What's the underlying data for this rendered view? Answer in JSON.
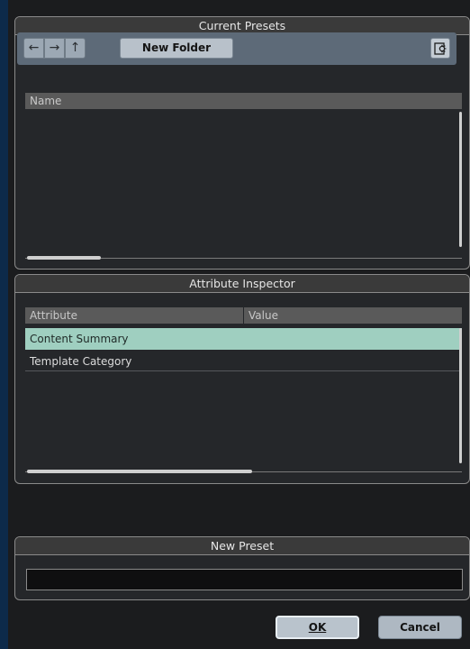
{
  "current_presets": {
    "title": "Current Presets",
    "toolbar": {
      "back_icon": "arrow-left-icon",
      "forward_icon": "arrow-right-icon",
      "up_icon": "arrow-up-icon",
      "new_folder_label": "New Folder",
      "settings_icon": "settings-icon"
    },
    "columns": [
      "Name"
    ],
    "items": []
  },
  "attribute_inspector": {
    "title": "Attribute Inspector",
    "columns": [
      "Attribute",
      "Value"
    ],
    "rows": [
      {
        "attribute": "Content Summary",
        "value": "",
        "selected": true
      },
      {
        "attribute": "Template Category",
        "value": "",
        "selected": false
      }
    ],
    "selected_row_color": "#9fcfc0"
  },
  "new_preset": {
    "title": "New Preset",
    "name_value": ""
  },
  "buttons": {
    "ok_label": "OK",
    "cancel_label": "Cancel"
  }
}
